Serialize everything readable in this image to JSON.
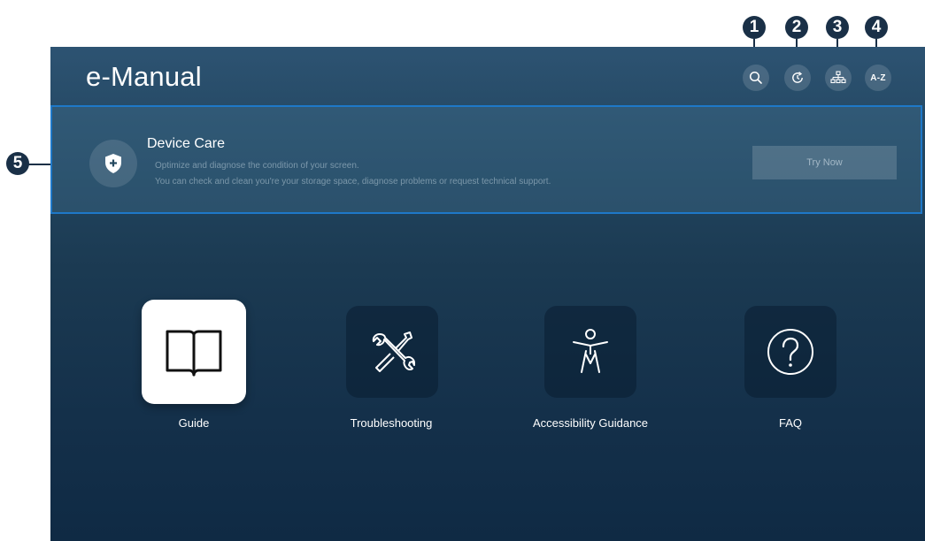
{
  "header": {
    "title": "e-Manual"
  },
  "toolbar": {
    "search": {
      "icon": "search-icon"
    },
    "recent": {
      "icon": "history-icon"
    },
    "sitemap": {
      "icon": "sitemap-icon"
    },
    "index": {
      "label": "A-Z"
    }
  },
  "device_care": {
    "title": "Device Care",
    "description_lines": [
      "Optimize and diagnose the condition of your screen.",
      "You can check and clean you're your storage space, diagnose problems or request technical support."
    ],
    "button_label": "Try Now",
    "icon": "shield-plus-icon"
  },
  "tiles": [
    {
      "label": "Guide",
      "icon": "book-icon",
      "focused": true
    },
    {
      "label": "Troubleshooting",
      "icon": "tools-icon",
      "focused": false
    },
    {
      "label": "Accessibility Guidance",
      "icon": "accessibility-icon",
      "focused": false
    },
    {
      "label": "FAQ",
      "icon": "question-icon",
      "focused": false
    }
  ],
  "callouts": [
    "1",
    "2",
    "3",
    "4",
    "5"
  ],
  "colors": {
    "accent_border": "#1e78c8",
    "badge": "#1a3047",
    "background_top": "#2d5372",
    "background_bottom": "#0f2a44"
  }
}
